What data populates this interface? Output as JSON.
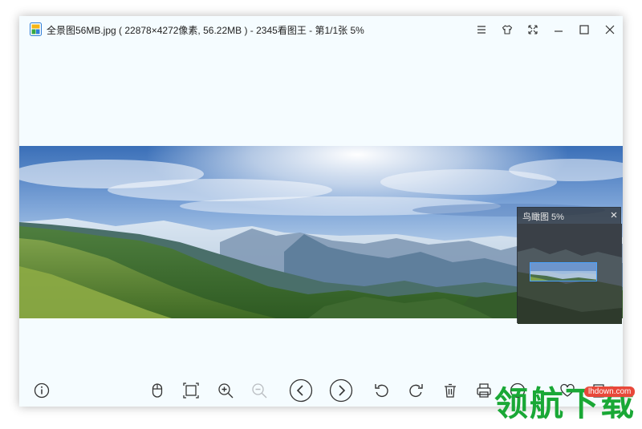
{
  "titlebar": {
    "title": "全景图56MB.jpg ( 22878×4272像素, 56.22MB ) - 2345看图王 - 第1/1张 5%",
    "icons": [
      "app-logo-icon",
      "menu-icon",
      "skin-icon",
      "fullscreen-icon",
      "minimize-icon",
      "maximize-icon",
      "close-icon"
    ]
  },
  "birdview": {
    "title": "鸟瞰图 5%"
  },
  "toolbar": {
    "icons": [
      "info-icon",
      "mouse-icon",
      "fit-window-icon",
      "zoom-in-icon",
      "zoom-out-icon",
      "prev-icon",
      "next-icon",
      "rotate-left-icon",
      "rotate-right-icon",
      "delete-icon",
      "print-icon",
      "edit-icon",
      "favorite-icon",
      "more-icon"
    ]
  },
  "watermark": {
    "text": "领航下载",
    "url": "lhdown.com"
  },
  "colors": {
    "window_bg": "#f5fcff",
    "accent_blue": "#4aa3ff",
    "watermark_green": "#1aa836",
    "watermark_red": "#e8483a"
  }
}
